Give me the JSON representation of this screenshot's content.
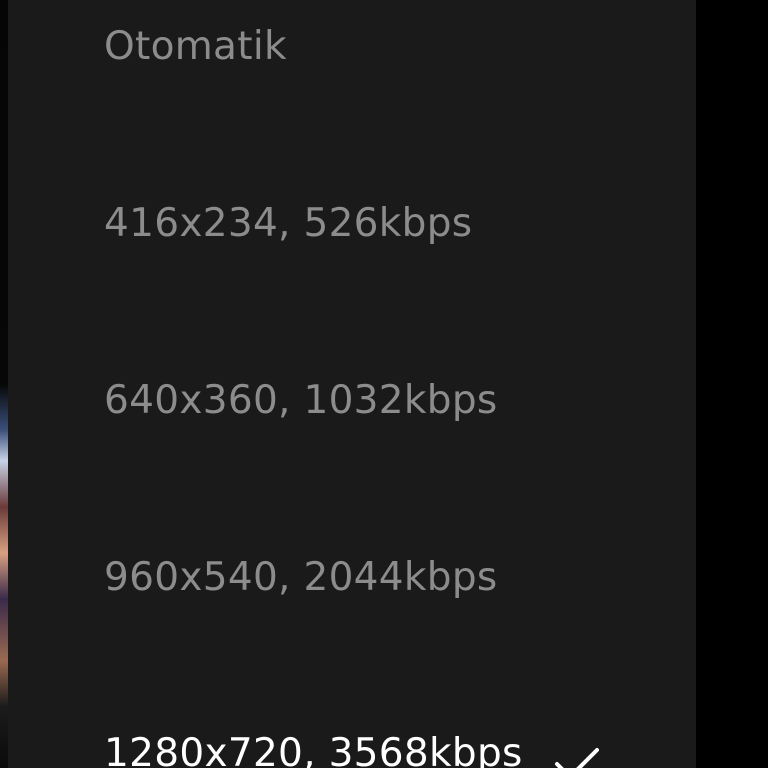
{
  "quality_menu": {
    "items": [
      {
        "label": "Otomatik",
        "selected": false
      },
      {
        "label": "416x234, 526kbps",
        "selected": false
      },
      {
        "label": "640x360, 1032kbps",
        "selected": false
      },
      {
        "label": "960x540, 2044kbps",
        "selected": false
      },
      {
        "label": "1280x720, 3568kbps",
        "selected": true
      }
    ],
    "selected_icon": "checkmark-icon"
  },
  "colors": {
    "menu_background": "#1a1a1a",
    "item_text": "#8c8c8c",
    "selected_text": "#ffffff"
  }
}
